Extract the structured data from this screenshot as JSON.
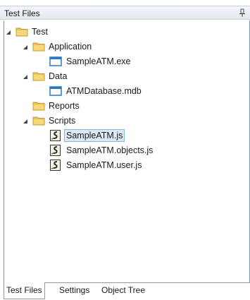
{
  "panel": {
    "title": "Test Files",
    "pin_icon": "pin-icon"
  },
  "tree": {
    "test": {
      "label": "Test",
      "expanded": true,
      "icon": "folder-icon"
    },
    "application": {
      "label": "Application",
      "expanded": true,
      "icon": "folder-icon"
    },
    "sample_exe": {
      "label": "SampleATM.exe",
      "icon": "app-window-icon"
    },
    "data": {
      "label": "Data",
      "expanded": true,
      "icon": "folder-icon"
    },
    "atm_db": {
      "label": "ATMDatabase.mdb",
      "icon": "database-window-icon"
    },
    "reports": {
      "label": "Reports",
      "icon": "folder-icon"
    },
    "scripts": {
      "label": "Scripts",
      "expanded": true,
      "icon": "folder-icon"
    },
    "script_js": {
      "label": "SampleATM.js",
      "selected": true,
      "icon": "script-icon"
    },
    "script_objects": {
      "label": "SampleATM.objects.js",
      "icon": "script-icon"
    },
    "script_user": {
      "label": "SampleATM.user.js",
      "icon": "script-icon"
    }
  },
  "tabs": {
    "items": [
      "Test Files",
      "Settings",
      "Object Tree"
    ],
    "active": "Test Files"
  },
  "colors": {
    "folder": "#e8c35a",
    "selection_bg": "#dbe9f8",
    "selection_border": "#87b3e2",
    "border": "#8a9bb0"
  }
}
